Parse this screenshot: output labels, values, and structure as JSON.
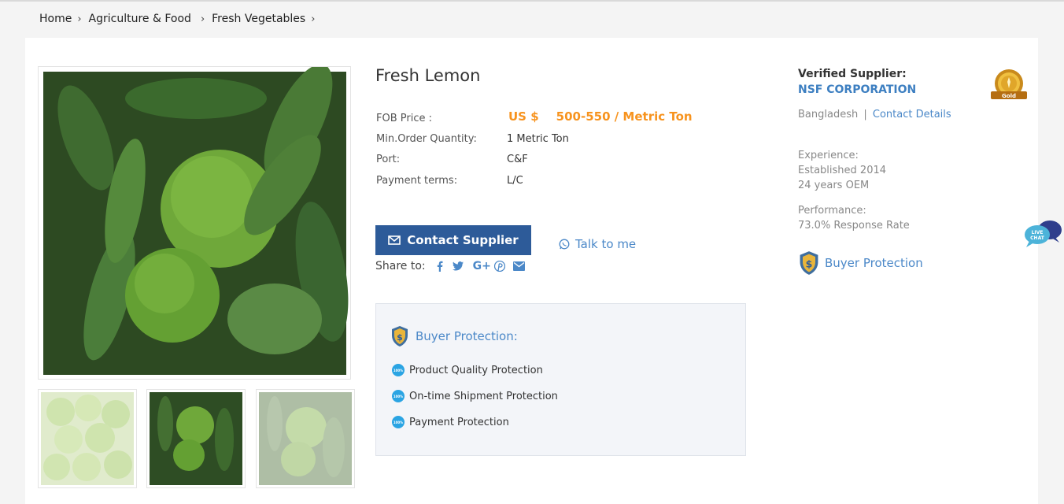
{
  "breadcrumb": [
    "Home",
    "Agriculture & Food",
    "Fresh Vegetables"
  ],
  "product": {
    "title": "Fresh Lemon",
    "specs": {
      "fob_label": "FOB Price :",
      "price_currency": "US $",
      "price_value": "500-550 / Metric Ton",
      "moq_label": "Min.Order Quantity:",
      "moq_value": "1 Metric Ton",
      "port_label": "Port:",
      "port_value": "C&F",
      "payment_label": "Payment terms:",
      "payment_value": "L/C"
    },
    "contact_label": "Contact Supplier",
    "talk_label": "Talk to me",
    "share_label": "Share to:",
    "share_icons": [
      "facebook-icon",
      "twitter-icon",
      "google-plus-icon",
      "pinterest-icon",
      "email-icon"
    ]
  },
  "buyer_protection_box": {
    "title": "Buyer Protection:",
    "badge_text": "100%",
    "items": [
      "Product Quality Protection",
      "On-time Shipment Protection",
      "Payment Protection"
    ]
  },
  "supplier": {
    "verified_label": "Verified Supplier:",
    "name": "NSF CORPORATION",
    "country": "Bangladesh",
    "separator": "|",
    "contact_details": "Contact Details",
    "experience_label": "Experience:",
    "established": "Established 2014",
    "years": "24 years OEM",
    "performance_label": "Performance:",
    "response_rate": "73.0% Response Rate",
    "buyer_protection": "Buyer Protection",
    "medal_text": "Gold"
  },
  "live_chat": "LIVE CHAT",
  "colors": {
    "accent_orange": "#f7931e",
    "button_blue": "#2d5b99",
    "link_blue": "#4b88c8"
  }
}
